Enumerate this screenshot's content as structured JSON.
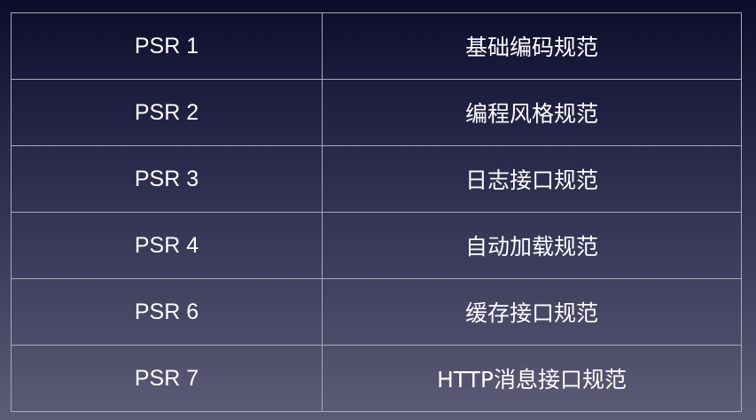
{
  "rows": [
    {
      "standard": "PSR 1",
      "description": "基础编码规范"
    },
    {
      "standard": "PSR 2",
      "description": "编程风格规范"
    },
    {
      "standard": "PSR 3",
      "description": "日志接口规范"
    },
    {
      "standard": "PSR 4",
      "description": "自动加载规范"
    },
    {
      "standard": "PSR 6",
      "description": "缓存接口规范"
    },
    {
      "standard": "PSR 7",
      "description": "HTTP消息接口规范"
    }
  ]
}
